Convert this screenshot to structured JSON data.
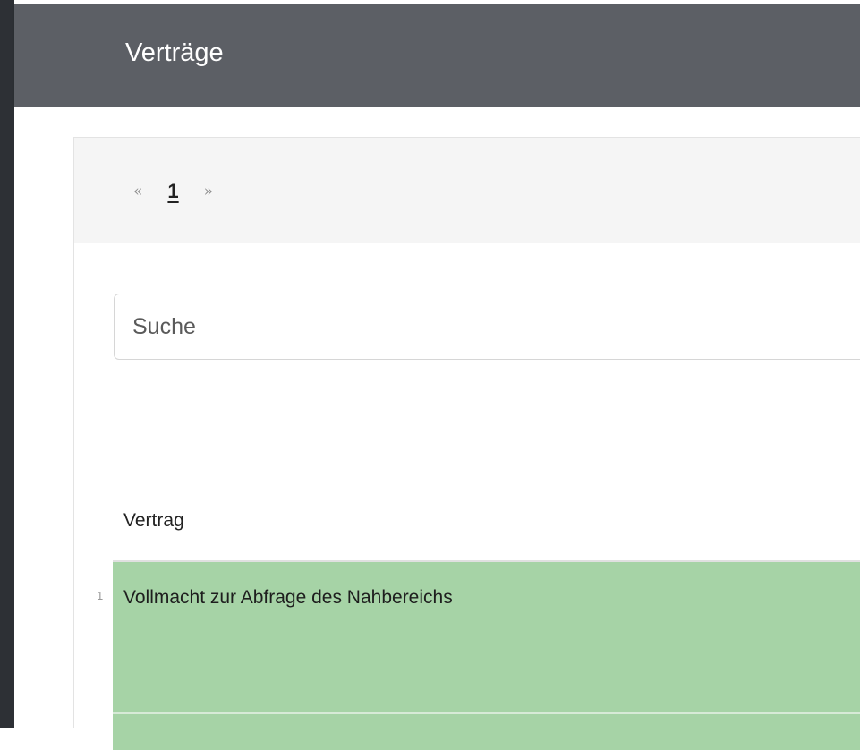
{
  "header": {
    "title": "Verträge"
  },
  "pagination": {
    "prev": "«",
    "current_page": "1",
    "next": "»"
  },
  "search": {
    "placeholder": "Suche",
    "value": ""
  },
  "table": {
    "column_header": "Vertrag",
    "rows": [
      {
        "number": "1",
        "title": "Vollmacht zur Abfrage des Nahbereichs",
        "row_color": "#a6d3a6"
      }
    ]
  },
  "colors": {
    "header_bg": "#5c5f65",
    "sidebar_bg": "#2d3035",
    "row_highlight": "#a6d3a6"
  }
}
